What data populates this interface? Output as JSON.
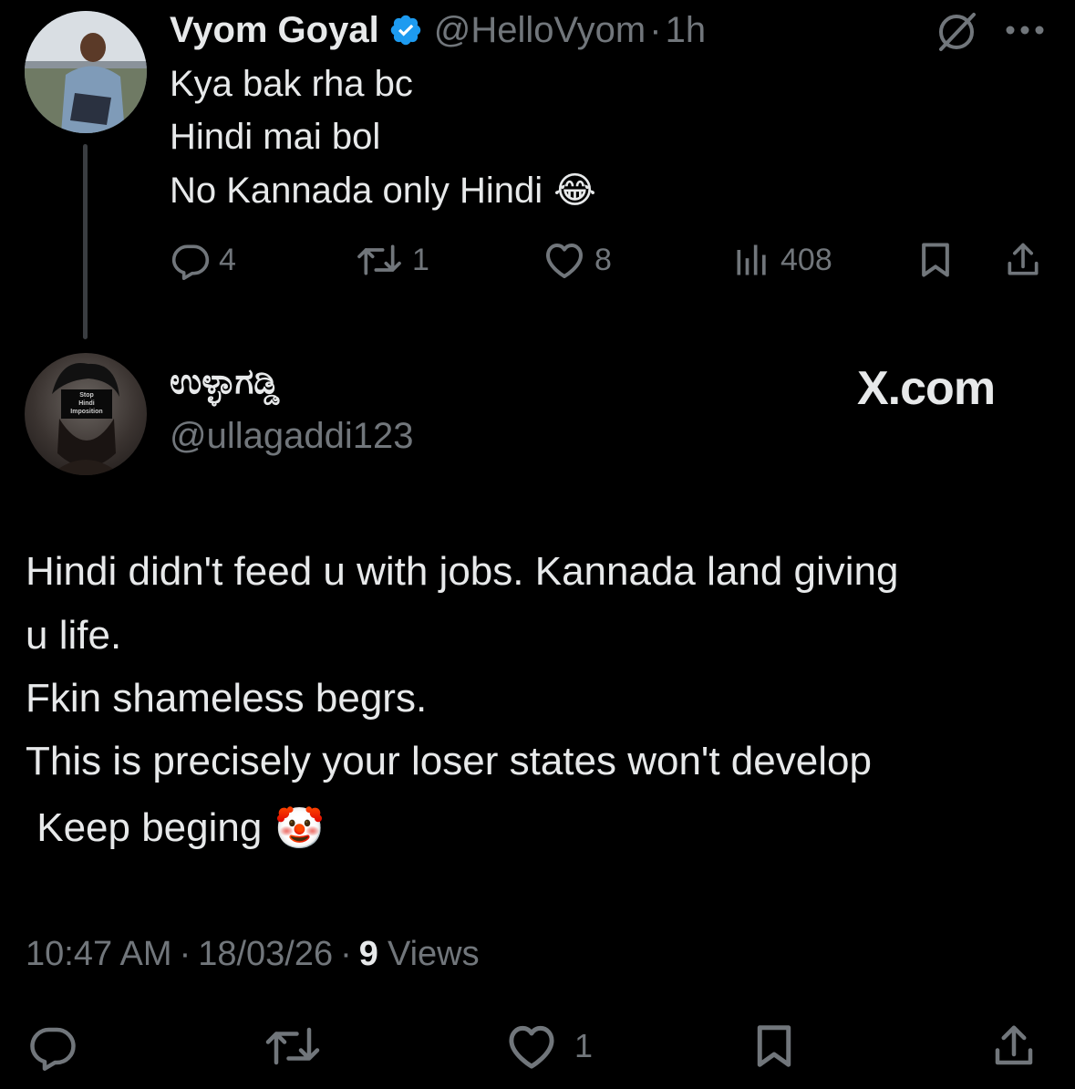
{
  "parent_tweet": {
    "display_name": "Vyom Goyal",
    "handle": "@HelloVyom",
    "separator": "·",
    "time": "1h",
    "lines": [
      "Kya bak rha bc",
      "Hindi mai bol",
      "No Kannada only Hindi"
    ],
    "emoji": "😂",
    "replies": "4",
    "reposts": "1",
    "likes": "8",
    "views": "408"
  },
  "main_tweet": {
    "display_name": "ಉಳ್ಳಾಗಡ್ಡಿ",
    "handle": "@ullagaddi123",
    "watermark": "X.com",
    "avatar_text": [
      "Stop",
      "Hindi",
      "Imposition"
    ],
    "lines": [
      "Hindi didn't feed u with jobs. Kannada land giving",
      "u life.",
      "Fkin shameless begrs.",
      "This is precisely your loser states won't develop",
      " Keep beging"
    ],
    "emoji": "🤡",
    "timestamp": "10:47 AM",
    "date": "18/03/26",
    "views_count": "9",
    "views_label": "Views",
    "dot": "·",
    "likes": "1"
  },
  "colors": {
    "background": "#000000",
    "text": "#e7e9ea",
    "muted": "#71767b",
    "verified": "#1d9bf0",
    "thread_line": "#3a3d41"
  },
  "icons": [
    "verified-badge-icon",
    "grok-icon",
    "more-icon",
    "reply-icon",
    "repost-icon",
    "like-icon",
    "views-icon",
    "bookmark-icon",
    "share-icon"
  ]
}
